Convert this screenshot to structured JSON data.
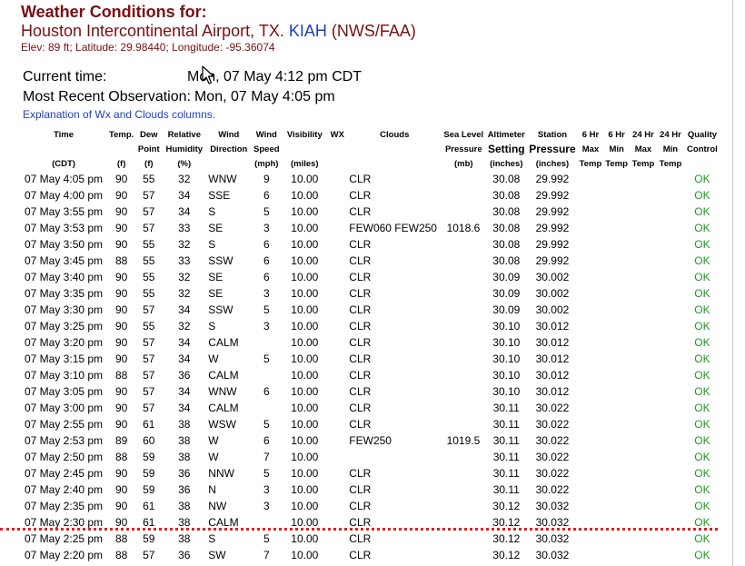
{
  "header": {
    "title": "Weather Conditions for:",
    "station_name": "Houston Intercontinental Airport, TX.",
    "station_code": "KIAH",
    "source": "(NWS/FAA)",
    "location": "Elev: 89 ft; Latitude: 29.98440; Longitude: -95.36074"
  },
  "times": {
    "current_label": "Current time:",
    "current_value": "Mon, 07 May 4:12 pm CDT",
    "recent_label": "Most Recent Observation:",
    "recent_value": "Mon, 07 May 4:05 pm"
  },
  "explanation_link": "Explanation of Wx and Clouds columns.",
  "columns": {
    "time": [
      "Time",
      "",
      "(CDT)"
    ],
    "temp": [
      "Temp.",
      "",
      "(f)"
    ],
    "dew": [
      "Dew",
      "Point",
      "(f)"
    ],
    "rh": [
      "Relative",
      "Humidity",
      "(%)"
    ],
    "wdir": [
      "Wind",
      "Direction",
      ""
    ],
    "wspd": [
      "Wind",
      "Speed",
      "(mph)"
    ],
    "vis": [
      "Visibility",
      "",
      "(miles)"
    ],
    "wx": [
      "WX",
      "",
      ""
    ],
    "clouds": [
      "Clouds",
      "",
      ""
    ],
    "slp": [
      "Sea Level",
      "Pressure",
      "(mb)"
    ],
    "alt": [
      "Altimeter",
      "Setting",
      "(inches)"
    ],
    "stp": [
      "Station",
      "Pressure",
      "(inches)"
    ],
    "max6": [
      "6 Hr",
      "Max",
      "Temp"
    ],
    "min6": [
      "6 Hr",
      "Min",
      "Temp"
    ],
    "max24": [
      "24 Hr",
      "Max",
      "Temp"
    ],
    "min24": [
      "24 Hr",
      "Min",
      "Temp"
    ],
    "qc": [
      "Quality",
      "Control",
      ""
    ]
  },
  "rows": [
    [
      "07 May 4:05 pm",
      "90",
      "55",
      "32",
      "WNW",
      "9",
      "10.00",
      "",
      "CLR",
      "",
      "30.08",
      "29.992",
      "",
      "",
      "",
      "",
      "OK"
    ],
    [
      "07 May 4:00 pm",
      "90",
      "57",
      "34",
      "SSE",
      "6",
      "10.00",
      "",
      "CLR",
      "",
      "30.08",
      "29.992",
      "",
      "",
      "",
      "",
      "OK"
    ],
    [
      "07 May 3:55 pm",
      "90",
      "57",
      "34",
      "S",
      "5",
      "10.00",
      "",
      "CLR",
      "",
      "30.08",
      "29.992",
      "",
      "",
      "",
      "",
      "OK"
    ],
    [
      "07 May 3:53 pm",
      "90",
      "57",
      "33",
      "SE",
      "3",
      "10.00",
      "",
      "FEW060 FEW250",
      "1018.6",
      "30.08",
      "29.992",
      "",
      "",
      "",
      "",
      "OK"
    ],
    [
      "07 May 3:50 pm",
      "90",
      "55",
      "32",
      "S",
      "6",
      "10.00",
      "",
      "CLR",
      "",
      "30.08",
      "29.992",
      "",
      "",
      "",
      "",
      "OK"
    ],
    [
      "07 May 3:45 pm",
      "88",
      "55",
      "33",
      "SSW",
      "6",
      "10.00",
      "",
      "CLR",
      "",
      "30.08",
      "29.992",
      "",
      "",
      "",
      "",
      "OK"
    ],
    [
      "07 May 3:40 pm",
      "90",
      "55",
      "32",
      "SE",
      "6",
      "10.00",
      "",
      "CLR",
      "",
      "30.09",
      "30.002",
      "",
      "",
      "",
      "",
      "OK"
    ],
    [
      "07 May 3:35 pm",
      "90",
      "55",
      "32",
      "SE",
      "3",
      "10.00",
      "",
      "CLR",
      "",
      "30.09",
      "30.002",
      "",
      "",
      "",
      "",
      "OK"
    ],
    [
      "07 May 3:30 pm",
      "90",
      "57",
      "34",
      "SSW",
      "5",
      "10.00",
      "",
      "CLR",
      "",
      "30.09",
      "30.002",
      "",
      "",
      "",
      "",
      "OK"
    ],
    [
      "07 May 3:25 pm",
      "90",
      "55",
      "32",
      "S",
      "3",
      "10.00",
      "",
      "CLR",
      "",
      "30.10",
      "30.012",
      "",
      "",
      "",
      "",
      "OK"
    ],
    [
      "07 May 3:20 pm",
      "90",
      "57",
      "34",
      "CALM",
      "",
      "10.00",
      "",
      "CLR",
      "",
      "30.10",
      "30.012",
      "",
      "",
      "",
      "",
      "OK"
    ],
    [
      "07 May 3:15 pm",
      "90",
      "57",
      "34",
      "W",
      "5",
      "10.00",
      "",
      "CLR",
      "",
      "30.10",
      "30.012",
      "",
      "",
      "",
      "",
      "OK"
    ],
    [
      "07 May 3:10 pm",
      "88",
      "57",
      "36",
      "CALM",
      "",
      "10.00",
      "",
      "CLR",
      "",
      "30.10",
      "30.012",
      "",
      "",
      "",
      "",
      "OK"
    ],
    [
      "07 May 3:05 pm",
      "90",
      "57",
      "34",
      "WNW",
      "6",
      "10.00",
      "",
      "CLR",
      "",
      "30.10",
      "30.012",
      "",
      "",
      "",
      "",
      "OK"
    ],
    [
      "07 May 3:00 pm",
      "90",
      "57",
      "34",
      "CALM",
      "",
      "10.00",
      "",
      "CLR",
      "",
      "30.11",
      "30.022",
      "",
      "",
      "",
      "",
      "OK"
    ],
    [
      "07 May 2:55 pm",
      "90",
      "61",
      "38",
      "WSW",
      "5",
      "10.00",
      "",
      "CLR",
      "",
      "30.11",
      "30.022",
      "",
      "",
      "",
      "",
      "OK"
    ],
    [
      "07 May 2:53 pm",
      "89",
      "60",
      "38",
      "W",
      "6",
      "10.00",
      "",
      "FEW250",
      "1019.5",
      "30.11",
      "30.022",
      "",
      "",
      "",
      "",
      "OK"
    ],
    [
      "07 May 2:50 pm",
      "88",
      "59",
      "38",
      "W",
      "7",
      "10.00",
      "",
      "",
      "",
      "30.11",
      "30.022",
      "",
      "",
      "",
      "",
      "OK"
    ],
    [
      "07 May 2:45 pm",
      "90",
      "59",
      "36",
      "NNW",
      "5",
      "10.00",
      "",
      "CLR",
      "",
      "30.11",
      "30.022",
      "",
      "",
      "",
      "",
      "OK"
    ],
    [
      "07 May 2:40 pm",
      "90",
      "59",
      "36",
      "N",
      "3",
      "10.00",
      "",
      "CLR",
      "",
      "30.11",
      "30.022",
      "",
      "",
      "",
      "",
      "OK"
    ],
    [
      "07 May 2:35 pm",
      "90",
      "61",
      "38",
      "NW",
      "3",
      "10.00",
      "",
      "CLR",
      "",
      "30.12",
      "30.032",
      "",
      "",
      "",
      "",
      "OK"
    ],
    [
      "07 May 2:30 pm",
      "90",
      "61",
      "38",
      "CALM",
      "",
      "10.00",
      "",
      "CLR",
      "",
      "30.12",
      "30.032",
      "",
      "",
      "",
      "",
      "OK"
    ],
    [
      "07 May 2:25 pm",
      "88",
      "59",
      "38",
      "S",
      "5",
      "10.00",
      "",
      "CLR",
      "",
      "30.12",
      "30.032",
      "",
      "",
      "",
      "",
      "OK"
    ],
    [
      "07 May 2:20 pm",
      "88",
      "57",
      "36",
      "SW",
      "7",
      "10.00",
      "",
      "CLR",
      "",
      "30.12",
      "30.032",
      "",
      "",
      "",
      "",
      "OK"
    ]
  ],
  "colors": {
    "title": "#7a0f12",
    "link": "#1f3fbf",
    "ok": "#1f9a1f",
    "separator": "#e02020"
  }
}
